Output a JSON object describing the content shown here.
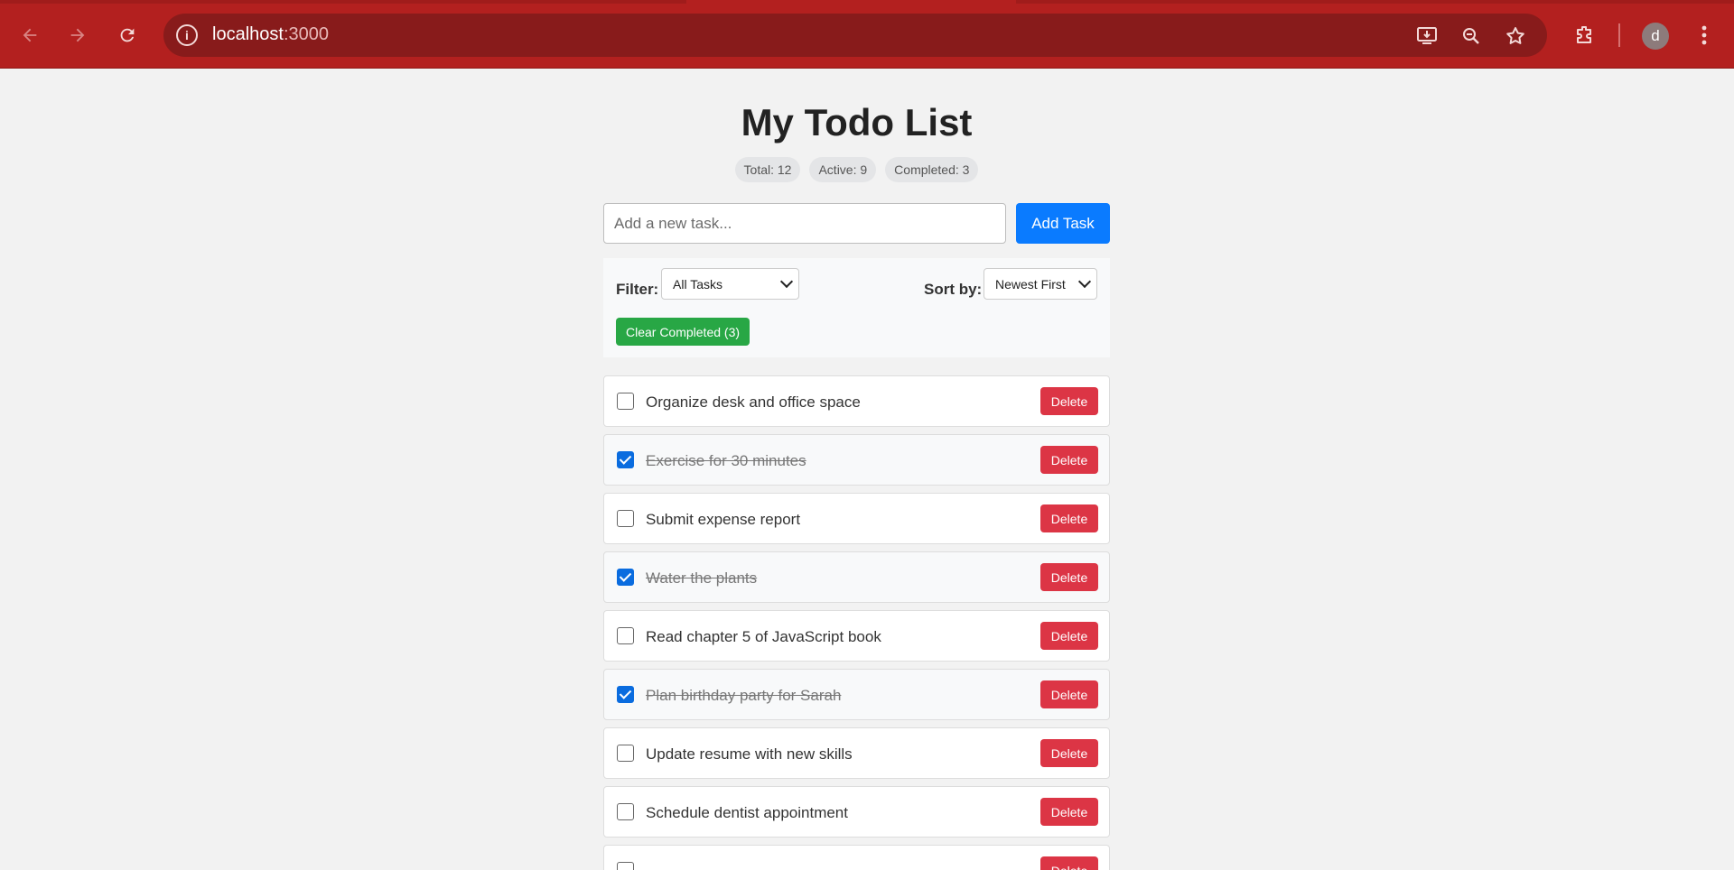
{
  "browser": {
    "url_host": "localhost",
    "url_port": ":3000",
    "profile_initial": "d"
  },
  "app": {
    "title": "My Todo List",
    "stats": {
      "total": "Total: 12",
      "active": "Active: 9",
      "completed": "Completed: 3"
    },
    "add": {
      "placeholder": "Add a new task...",
      "button_label": "Add Task"
    },
    "controls": {
      "filter_label": "Filter:",
      "filter_value": "All Tasks",
      "sort_label": "Sort by:",
      "sort_value": "Newest First",
      "clear_label": "Clear Completed (3)"
    },
    "delete_label": "Delete",
    "todos": [
      {
        "text": "Organize desk and office space",
        "completed": false
      },
      {
        "text": "Exercise for 30 minutes",
        "completed": true
      },
      {
        "text": "Submit expense report",
        "completed": false
      },
      {
        "text": "Water the plants",
        "completed": true
      },
      {
        "text": "Read chapter 5 of JavaScript book",
        "completed": false
      },
      {
        "text": "Plan birthday party for Sarah",
        "completed": true
      },
      {
        "text": "Update resume with new skills",
        "completed": false
      },
      {
        "text": "Schedule dentist appointment",
        "completed": false
      },
      {
        "text": "",
        "completed": false
      }
    ]
  },
  "colors": {
    "chrome": "#b3201f",
    "primary": "#0a7bff",
    "success": "#28a745",
    "danger": "#dc3545"
  }
}
